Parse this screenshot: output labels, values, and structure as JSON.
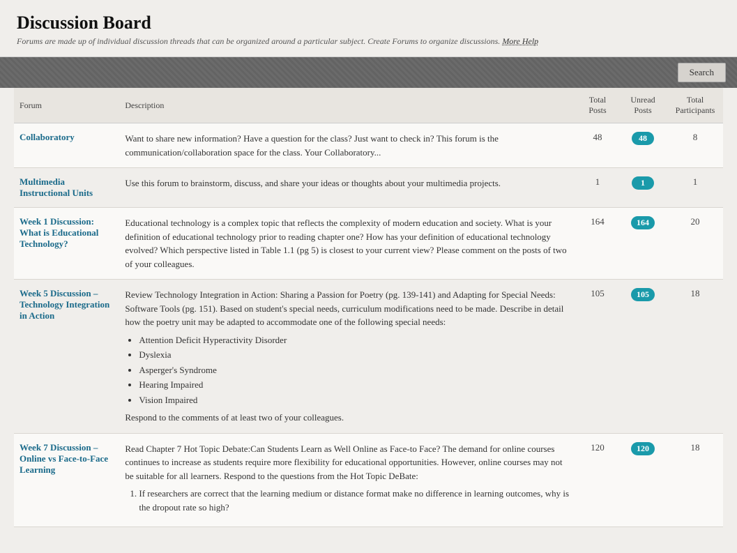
{
  "header": {
    "title": "Discussion Board",
    "subtitle": "Forums are made up of individual discussion threads that can be organized around a particular subject. Create Forums to organize discussions.",
    "help_link": "More Help"
  },
  "toolbar": {
    "search_label": "Search"
  },
  "table": {
    "columns": {
      "forum": "Forum",
      "description": "Description",
      "total_posts": "Total Posts",
      "unread_posts": "Unread Posts",
      "total_participants": "Total Participants"
    },
    "rows": [
      {
        "id": "collaboratory",
        "name": "Collaboratory",
        "description": "Want to share new information? Have a question for the class? Just want to check in? This forum is the communication/collaboration space for the class. Your Collaboratory...",
        "total_posts": 48,
        "unread_posts": 48,
        "total_participants": 8,
        "list_items": [],
        "numbered_items": []
      },
      {
        "id": "multimedia",
        "name": "Multimedia Instructional Units",
        "description": "Use this forum to brainstorm, discuss, and share your ideas or thoughts about your multimedia projects.",
        "total_posts": 1,
        "unread_posts": 1,
        "total_participants": 1,
        "list_items": [],
        "numbered_items": []
      },
      {
        "id": "week1",
        "name": "Week 1 Discussion: What is Educational Technology?",
        "description": "Educational technology is a complex topic that reflects the complexity of modern education and society. What is your definition of educational technology prior to reading chapter one?  How has your definition of educational technology evolved?  Which perspective listed in Table 1.1 (pg 5) is closest to your current view?  Please comment on the posts of two of your colleagues.",
        "total_posts": 164,
        "unread_posts": 164,
        "total_participants": 20,
        "list_items": [],
        "numbered_items": []
      },
      {
        "id": "week5",
        "name": "Week 5 Discussion – Technology Integration in Action",
        "description": "Review Technology Integration in Action: Sharing a Passion for Poetry (pg. 139-141) and Adapting for Special Needs: Software Tools (pg. 151). Based on student's special needs, curriculum modifications need to be made. Describe in detail how the poetry unit may be adapted to accommodate one of the following special needs:",
        "total_posts": 105,
        "unread_posts": 105,
        "total_participants": 18,
        "list_items": [
          "Attention Deficit Hyperactivity Disorder",
          "Dyslexia",
          "Asperger's Syndrome",
          "Hearing Impaired",
          "Vision Impaired"
        ],
        "list_footer": "Respond to the comments of at least two of your colleagues.",
        "numbered_items": []
      },
      {
        "id": "week7",
        "name": "Week 7 Discussion – Online vs Face-to-Face Learning",
        "description": "Read Chapter 7 Hot Topic Debate:Can Students Learn as Well Online as Face-to Face? The demand for online courses continues to increase as students require more flexibility for educational opportunities. However, online courses may not be suitable for all learners.  Respond to the questions from the Hot Topic DeBate:",
        "total_posts": 120,
        "unread_posts": 120,
        "total_participants": 18,
        "list_items": [],
        "numbered_items": [
          "If researchers are correct that the learning medium or distance format make no difference in learning outcomes, why is the dropout rate so high?"
        ],
        "numbered_footer": ""
      }
    ]
  }
}
